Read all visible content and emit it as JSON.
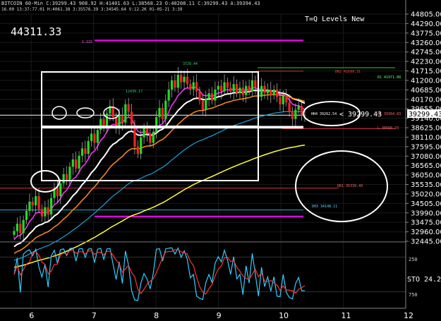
{
  "header": {
    "line1": "BITCOIN 60-Min C:39299.43 908.92 H:41401.63 L:38568.23 O:40208.11 C:39299.43 A:39394.43",
    "line2": "16.00 13:37:77.01 H:4061.38 3:35576.39 3:34545.64 V:12.2K 01-05-21 3:39"
  },
  "big_price": "44311.33",
  "title": "T=Q Levels New",
  "current_price_tag": "39299.43",
  "callout": "< 39299.43",
  "colors": {
    "up_candle": "#22dd22",
    "down_candle": "#ff2222",
    "ema_fast": "#ff33ff",
    "ema_white": "#ffffff",
    "ema_orange": "#ff8c1a",
    "ema_cyan": "#1aa3d9",
    "sma_yellow": "#ffff33",
    "level_magenta": "#ff00ff",
    "stoch_k": "#33ccff",
    "stoch_d": "#ff3333"
  },
  "annotations": {
    "peak_label": "3728.44",
    "left_label": "12439.17",
    "line_top": "1.222",
    "dr2": "DR2 41699.31",
    "r1": "R1 41971.88",
    "mid_tag": "HH4 39262.54",
    "lvl_right": "HL 39304.83",
    "l_label": "L 38568.23",
    "dr1": "DR1 35339.49",
    "dh3": "DH3 34148.11"
  },
  "stoch": {
    "label": "STO",
    "value": "24.2",
    "ticks": [
      "250",
      "750"
    ]
  },
  "chart_data": {
    "type": "candlestick",
    "title": "BITCOIN 60-Min",
    "ylim": [
      32445,
      44805
    ],
    "y_ticks": [
      "44805.00",
      "44290.00",
      "43775.00",
      "43260.00",
      "42745.00",
      "42230.00",
      "41715.00",
      "41200.00",
      "40685.00",
      "40170.00",
      "39655.00",
      "39140.00",
      "38625.00",
      "38110.00",
      "37595.00",
      "37080.00",
      "36565.00",
      "36050.00",
      "35535.00",
      "35020.00",
      "34505.00",
      "33990.00",
      "33475.00",
      "32960.00",
      "32445.00"
    ],
    "x_ticks": [
      "6",
      "7",
      "8",
      "9",
      "10",
      "11",
      "12"
    ],
    "x_range": [
      5.5,
      12.0
    ],
    "closes": [
      33000,
      33400,
      32900,
      33600,
      34100,
      34600,
      34400,
      34900,
      34200,
      33800,
      34300,
      33900,
      34800,
      35300,
      34900,
      35600,
      36100,
      35800,
      36500,
      36900,
      36400,
      37100,
      37500,
      37200,
      37900,
      38300,
      37800,
      38500,
      39100,
      38700,
      39400,
      39800,
      39200,
      38600,
      39300,
      38900,
      39900,
      39500,
      38800,
      37600,
      37200,
      38100,
      38600,
      38300,
      37800,
      38400,
      39200,
      39700,
      39100,
      40100,
      40700,
      41200,
      40800,
      41500,
      41100,
      41400,
      41000,
      40700,
      41100,
      40600,
      40100,
      39600,
      40200,
      40500,
      40100,
      40700,
      40900,
      40600,
      41100,
      40800,
      40600,
      41000,
      40500,
      40800,
      40400,
      40900,
      40600,
      41200,
      40800,
      40300,
      40900,
      40500,
      40700,
      40400,
      40700,
      40300,
      39900,
      40400,
      40000,
      39500,
      39100,
      39600,
      39800,
      39300,
      39299.43
    ],
    "moving_averages": [
      {
        "name": "fast EMA",
        "period": 8
      },
      {
        "name": "white EMA",
        "period": 18
      },
      {
        "name": "orange EMA",
        "period": 30
      },
      {
        "name": "cyan EMA",
        "period": 60
      },
      {
        "name": "yellow SMA",
        "period": 120
      }
    ],
    "levels": [
      {
        "value": 43375,
        "color": "#ff00ff"
      },
      {
        "value": 41700,
        "color": "#cc3333"
      },
      {
        "value": 41890,
        "color": "#33cc33"
      },
      {
        "value": 39305,
        "color": "#ffffff"
      },
      {
        "value": 38600,
        "color": "#ffffff"
      },
      {
        "value": 38568,
        "color": "#cc3333"
      },
      {
        "value": 35339,
        "color": "#cc3333"
      },
      {
        "value": 34148,
        "color": "#33aadd"
      },
      {
        "value": 33800,
        "color": "#ff00ff"
      }
    ]
  }
}
